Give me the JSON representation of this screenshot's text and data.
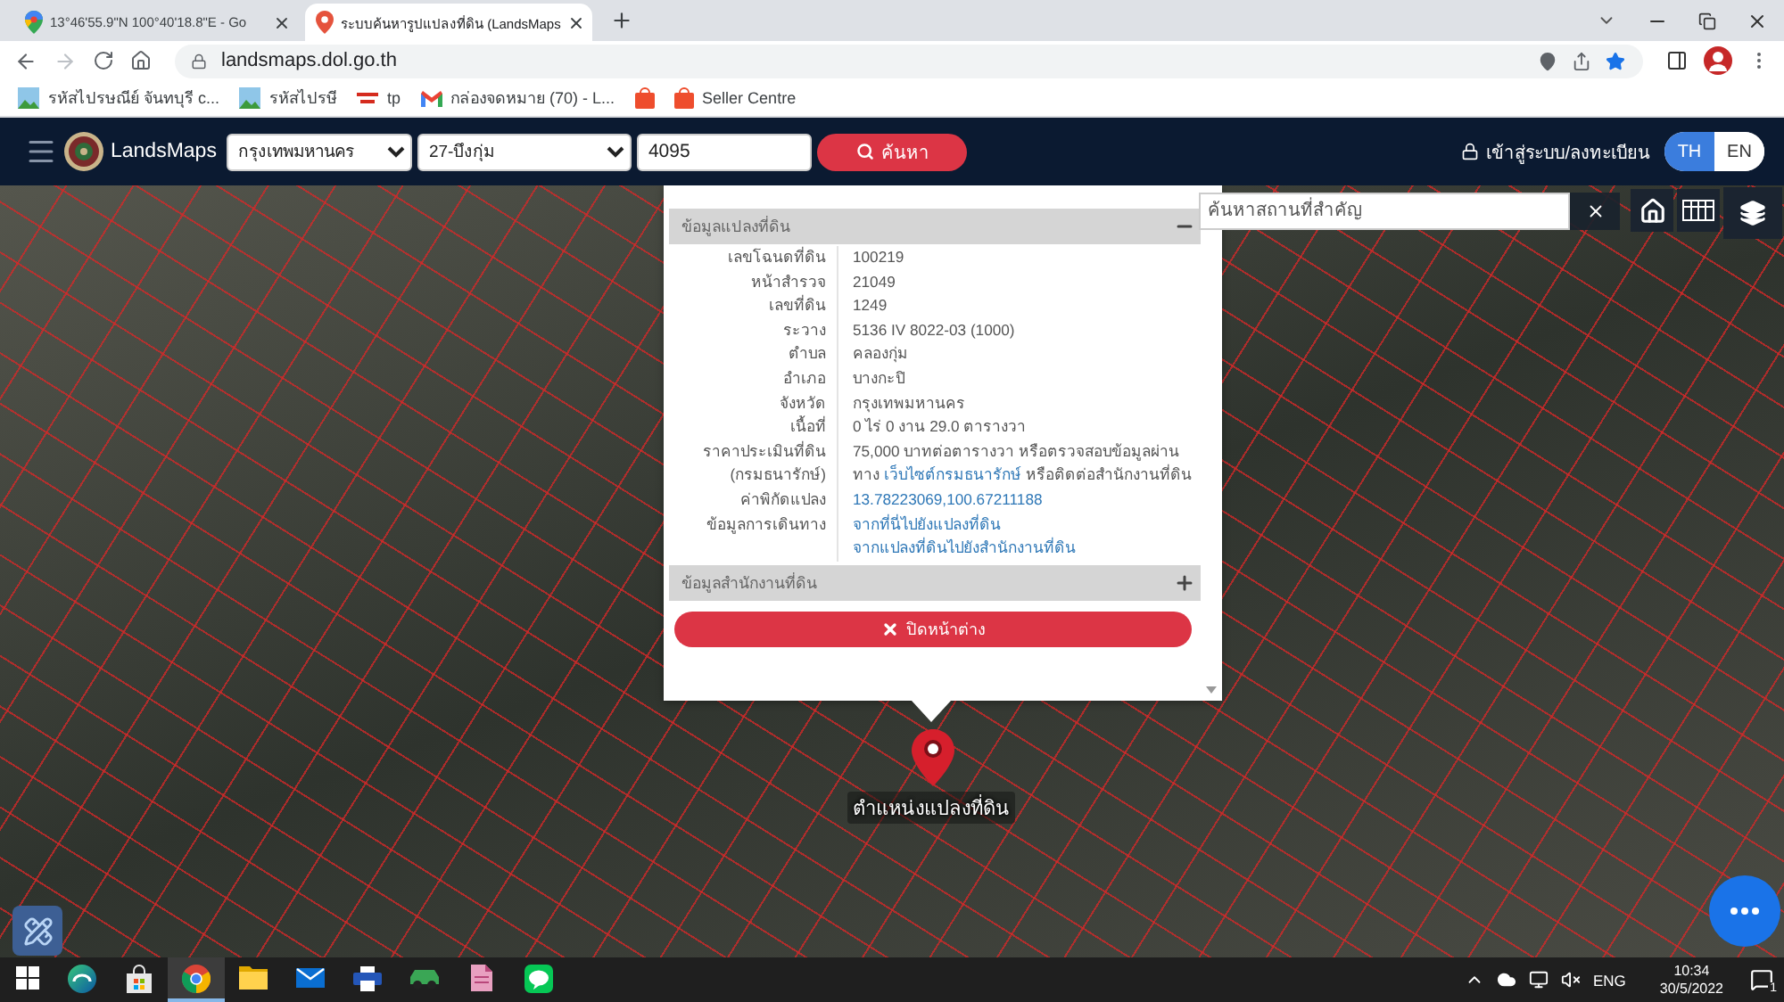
{
  "browser": {
    "tabs": [
      {
        "kind": "maps",
        "title": "13°46'55.9\"N 100°40'18.8\"E - Go",
        "selected": false
      },
      {
        "kind": "pin",
        "title": "ระบบค้นหารูปแปลงที่ดิน (LandsMaps",
        "selected": true
      }
    ],
    "url": "landsmaps.dol.go.th",
    "bookmarked": true,
    "bookmarks": [
      {
        "kind": "image",
        "label": "รหัสไปรษณีย์ จันทบุรี c..."
      },
      {
        "kind": "image",
        "label": "รหัสไปรษี"
      },
      {
        "kind": "logo",
        "label": "tp"
      },
      {
        "kind": "mail",
        "label": "กล่องจดหมาย (70) - L..."
      },
      {
        "kind": "shop"
      },
      {
        "kind": "shop",
        "label": "Seller Centre"
      }
    ]
  },
  "header": {
    "brand": "LandsMaps",
    "province": "กรุงเทพมหานคร",
    "district": "27-บึงกุ่ม",
    "parcel_number": "4095",
    "search_button": "ค้นหา",
    "login": "เข้าสู่ระบบ/ลงทะเบียน",
    "languages": [
      {
        "label": "TH",
        "selected": true
      },
      {
        "label": "EN",
        "selected": false
      }
    ]
  },
  "map": {
    "place_search": {
      "placeholder": "ค้นหาสถานที่สำคัญ"
    },
    "marker_label": "ตำแหน่งแปลงที่ดิน",
    "popup": {
      "sections": [
        {
          "title": "ข้อมูลแปลงที่ดิน",
          "expanded": true,
          "rows": [
            {
              "label": "เลขโฉนดที่ดิน",
              "kind": "text",
              "value": "100219"
            },
            {
              "label": "หน้าสำรวจ",
              "kind": "text",
              "value": "21049"
            },
            {
              "label": "เลขที่ดิน",
              "kind": "text",
              "value": "1249"
            },
            {
              "label": "ระวาง",
              "kind": "text",
              "value": "5136 IV 8022-03 (1000)"
            },
            {
              "label": "ตำบล",
              "kind": "text",
              "value": "คลองกุ่ม"
            },
            {
              "label": "อำเภอ",
              "kind": "text",
              "value": "บางกะปิ"
            },
            {
              "label": "จังหวัด",
              "kind": "text",
              "value": "กรุงเทพมหานคร"
            },
            {
              "label": "เนื้อที่",
              "kind": "text",
              "value": "0 ไร่ 0 งาน 29.0 ตารางวา"
            },
            {
              "label": "ราคาประเมินที่ดิน",
              "label_note": "(กรมธนารักษ์)",
              "kind": "price",
              "value": "75,000 บาทต่อตารางวา หรือตรวจสอบข้อมูลผ่านทาง",
              "link": "เว็บไซต์กรมธนารักษ์",
              "value_after": "หรือติดต่อสำนักงานที่ดิน"
            },
            {
              "label": "ค่าพิกัดแปลง",
              "kind": "link",
              "value": "13.78223069,100.67211188"
            },
            {
              "label": "ข้อมูลการเดินทาง",
              "kind": "links",
              "links": [
                "จากที่นี่ไปยังแปลงที่ดิน",
                "จากแปลงที่ดินไปยังสำนักงานที่ดิน"
              ]
            }
          ]
        },
        {
          "title": "ข้อมูลสำนักงานที่ดิน",
          "expanded": false
        }
      ],
      "close_button": "ปิดหน้าต่าง"
    }
  },
  "taskbar": {
    "apps": [
      {
        "kind": "start",
        "selected": false
      },
      {
        "kind": "swirl",
        "selected": false
      },
      {
        "kind": "store",
        "selected": false
      },
      {
        "kind": "browser",
        "selected": true
      },
      {
        "kind": "folder",
        "selected": false
      },
      {
        "kind": "mail",
        "selected": false
      },
      {
        "kind": "printer",
        "selected": false
      },
      {
        "kind": "car",
        "selected": false
      },
      {
        "kind": "document",
        "selected": false
      },
      {
        "kind": "chat",
        "selected": false
      }
    ],
    "language": "ENG",
    "time": "10:34",
    "date": "30/5/2022",
    "notifications": "1"
  }
}
